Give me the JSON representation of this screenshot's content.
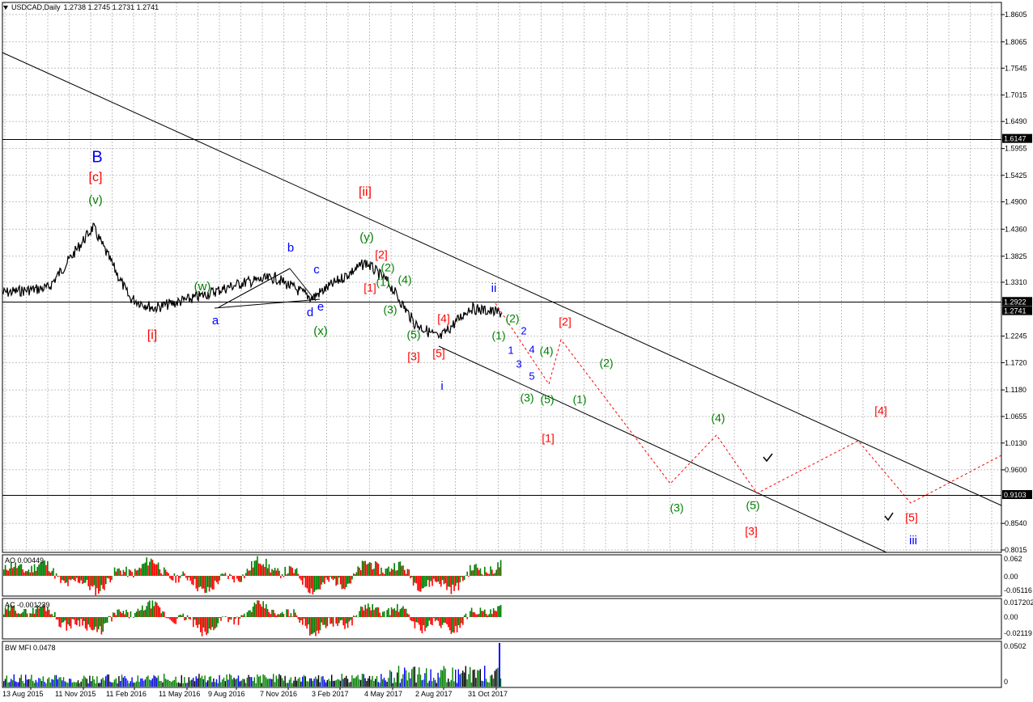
{
  "header": {
    "symbol": "USDCAD,Daily",
    "ohlc": "1.2738 1.2745 1.2731 1.2741"
  },
  "colors": {
    "grid": "#c0c0c0",
    "price": "#000000",
    "bull": "#008000",
    "bear": "#ff0000",
    "red_label": "#ff0000",
    "blue_label": "#0000ff",
    "green_label": "#008000",
    "projection": "#ff0000",
    "highlight_box": "#000000"
  },
  "price_axis": {
    "ticks": [
      "1.8605",
      "1.8065",
      "1.7545",
      "1.7015",
      "1.6490",
      "1.5955",
      "1.5425",
      "1.4900",
      "1.4360",
      "1.3825",
      "1.3310",
      "1.2245",
      "1.1720",
      "1.1180",
      "1.0655",
      "1.0130",
      "0.9600",
      "0.8540",
      "0.8015"
    ],
    "highlighted": [
      "1.6147",
      "1.2922",
      "1.2741",
      "0.9103"
    ]
  },
  "time_axis": {
    "ticks": [
      "13 Aug 2015",
      "11 Nov 2015",
      "11 Feb 2016",
      "11 May 2016",
      "9 Aug 2016",
      "7 Nov 2016",
      "3 Feb 2017",
      "4 May 2017",
      "2 Aug 2017",
      "31 Oct 2017"
    ]
  },
  "wave_labels": [
    {
      "text": "B",
      "color": "blue",
      "size": 20
    },
    {
      "text": "[c]",
      "color": "red",
      "size": 16
    },
    {
      "text": "(v)",
      "color": "green",
      "size": 15
    },
    {
      "text": "[i]",
      "color": "red",
      "size": 16
    },
    {
      "text": "(w)",
      "color": "green",
      "size": 15
    },
    {
      "text": "a",
      "color": "blue",
      "size": 15
    },
    {
      "text": "b",
      "color": "blue",
      "size": 15
    },
    {
      "text": "c",
      "color": "blue",
      "size": 15
    },
    {
      "text": "d",
      "color": "blue",
      "size": 15
    },
    {
      "text": "e",
      "color": "blue",
      "size": 15
    },
    {
      "text": "(x)",
      "color": "green",
      "size": 15
    },
    {
      "text": "[ii]",
      "color": "red",
      "size": 16
    },
    {
      "text": "(y)",
      "color": "green",
      "size": 15
    },
    {
      "text": "[2]",
      "color": "red",
      "size": 14
    },
    {
      "text": "[1]",
      "color": "red",
      "size": 14
    },
    {
      "text": "(2)",
      "color": "green",
      "size": 14
    },
    {
      "text": "(1)",
      "color": "green",
      "size": 14
    },
    {
      "text": "(4)",
      "color": "green",
      "size": 14
    },
    {
      "text": "(3)",
      "color": "green",
      "size": 14
    },
    {
      "text": "(5)",
      "color": "green",
      "size": 14
    },
    {
      "text": "[3]",
      "color": "red",
      "size": 14
    },
    {
      "text": "[4]",
      "color": "red",
      "size": 14
    },
    {
      "text": "[5]",
      "color": "red",
      "size": 14
    },
    {
      "text": "i",
      "color": "blue",
      "size": 15
    },
    {
      "text": "ii",
      "color": "blue",
      "size": 15
    },
    {
      "text": "(2)",
      "color": "green",
      "size": 14
    },
    {
      "text": "(1)",
      "color": "green",
      "size": 14
    },
    {
      "text": "2",
      "color": "blue",
      "size": 13
    },
    {
      "text": "1",
      "color": "blue",
      "size": 13
    },
    {
      "text": "4",
      "color": "blue",
      "size": 13
    },
    {
      "text": "(4)",
      "color": "green",
      "size": 14
    },
    {
      "text": "3",
      "color": "blue",
      "size": 13
    },
    {
      "text": "5",
      "color": "blue",
      "size": 13
    },
    {
      "text": "(3)",
      "color": "green",
      "size": 14
    },
    {
      "text": "(5)",
      "color": "green",
      "size": 14
    },
    {
      "text": "[2]",
      "color": "red",
      "size": 14
    },
    {
      "text": "(2)",
      "color": "green",
      "size": 14
    },
    {
      "text": "(1)",
      "color": "green",
      "size": 14
    },
    {
      "text": "[1]",
      "color": "red",
      "size": 14
    },
    {
      "text": "(4)",
      "color": "green",
      "size": 14
    },
    {
      "text": "[4]",
      "color": "red",
      "size": 14
    },
    {
      "text": "(3)",
      "color": "green",
      "size": 14
    },
    {
      "text": "(5)",
      "color": "green",
      "size": 14
    },
    {
      "text": "[3]",
      "color": "red",
      "size": 14
    },
    {
      "text": "[5]",
      "color": "red",
      "size": 14
    },
    {
      "text": "iii",
      "color": "blue",
      "size": 15
    }
  ],
  "indicators": {
    "ao": {
      "label": "AO 0.00449",
      "ticks": [
        "0.062",
        "0.00",
        "-0.05116"
      ]
    },
    "ac": {
      "label": "AC -0.001239",
      "ticks": [
        "0.017202",
        "0.00",
        "-0.02119"
      ]
    },
    "mfi": {
      "label": "BW MFI 0.0478",
      "ticks": [
        "0.0502",
        "0"
      ]
    }
  },
  "chart_data": {
    "type": "line",
    "title": "USDCAD,Daily",
    "price_range": [
      0.8015,
      1.8605
    ],
    "x": [
      "13 Aug 2015",
      "11 Nov 2015",
      "11 Feb 2016",
      "11 May 2016",
      "9 Aug 2016",
      "7 Nov 2016",
      "3 Feb 2017",
      "4 May 2017",
      "2 Aug 2017",
      "31 Oct 2017"
    ],
    "series": [
      {
        "values": [
          1.31,
          1.32,
          1.44,
          1.3,
          1.28,
          1.3,
          1.33,
          1.34,
          1.3,
          1.37,
          1.33,
          1.25,
          1.22,
          1.28,
          1.27
        ]
      }
    ],
    "horizontal_levels": [
      1.6147,
      1.2922,
      0.9103
    ]
  }
}
